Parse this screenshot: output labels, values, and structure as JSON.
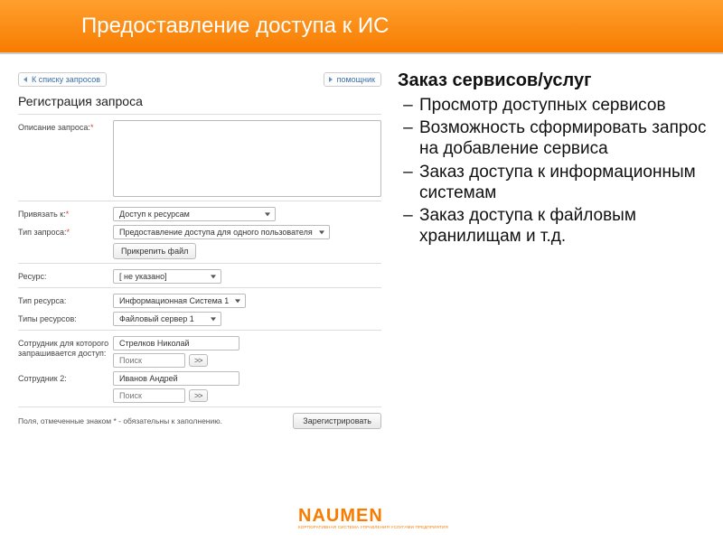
{
  "header": {
    "title": "Предоставление доступа к ИС"
  },
  "form": {
    "back_link": "К списку запросов",
    "help_link": "помощник",
    "title": "Регистрация запроса",
    "fields": {
      "description_label": "Описание запроса:",
      "bind_label": "Привязать к:",
      "bind_value": "Доступ к ресурсам",
      "type_label": "Тип запроса:",
      "type_value": "Предоставление доступа для одного пользователя",
      "attach_btn": "Прикрепить файл",
      "resource_label": "Ресурс:",
      "resource_value": "[ не указано]",
      "res_type_label": "Тип ресурса:",
      "res_type_value": "Информационная Система 1",
      "res_types_label": "Типы ресурсов:",
      "res_types_value": "Файловый сервер 1",
      "emp1_label": "Сотрудник для которого запрашивается доступ:",
      "emp1_value": "Стрелков Николай",
      "emp2_label": "Сотрудник 2:",
      "emp2_value": "Иванов Андрей",
      "search_placeholder": "Поиск",
      "browse_btn": ">>"
    },
    "footer_note": "Поля, отмеченные знаком * - обязательны к заполнению.",
    "submit": "Зарегистрировать"
  },
  "side": {
    "heading": "Заказ сервисов/услуг",
    "bullets": [
      "Просмотр доступных сервисов",
      "Возможность сформировать запрос на добавление сервиса",
      "Заказ доступа к информационным системам",
      "Заказ доступа к файловым хранилищам и т.д."
    ]
  },
  "logo": {
    "word": "NAUMEN",
    "sub": "КОРПОРАТИВНАЯ СИСТЕМА УПРАВЛЕНИЯ УСЛУГАМИ ПРЕДПРИЯТИЯ"
  }
}
